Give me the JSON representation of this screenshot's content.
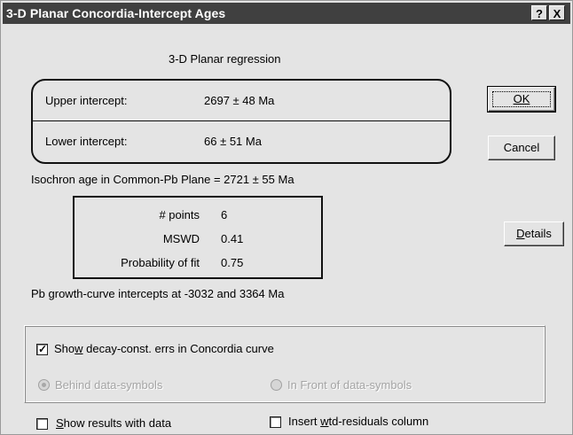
{
  "window": {
    "title": "3-D Planar Concordia-Intercept Ages",
    "help_button": "?",
    "close_button": "X"
  },
  "regression_title": "3-D Planar regression",
  "intercepts": {
    "upper_label": "Upper intercept:",
    "upper_value": "2697 ± 48 Ma",
    "lower_label": "Lower intercept:",
    "lower_value": "66 ± 51 Ma"
  },
  "isochron_text": "Isochron age in Common-Pb Plane = 2721 ± 55 Ma",
  "stats": {
    "points_label": "# points",
    "points_value": "6",
    "mswd_label": "MSWD",
    "mswd_value": "0.41",
    "prob_label": "Probability of fit",
    "prob_value": "0.75"
  },
  "growth_curve_text": "Pb growth-curve intercepts at -3032 and 3364 Ma",
  "buttons": {
    "ok": "OK",
    "cancel": "Cancel",
    "details_underlined": "D",
    "details_rest": "etails"
  },
  "options": {
    "decay_pre": "Sho",
    "decay_underlined": "w",
    "decay_post": " decay-const. errs in Concordia curve",
    "decay_checked": true,
    "behind_label": "Behind data-symbols",
    "front_label": "In Front of data-symbols",
    "show_results_underlined": "S",
    "show_results_rest": "how results with data",
    "show_results_checked": false,
    "insert_pre": "Insert ",
    "insert_underlined": "w",
    "insert_post": "td-residuals column",
    "insert_checked": false
  }
}
